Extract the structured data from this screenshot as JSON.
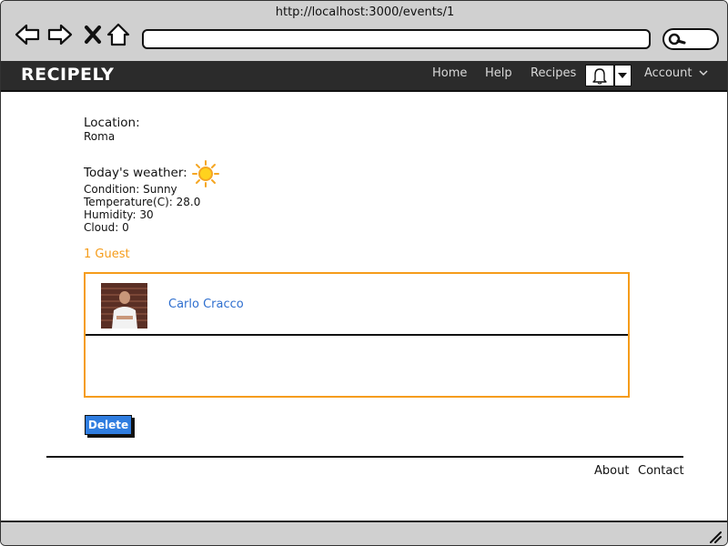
{
  "browser": {
    "url": "http://localhost:3000/events/1",
    "icons": [
      "back-icon",
      "forward-icon",
      "close-icon",
      "home-icon",
      "search-icon"
    ]
  },
  "navbar": {
    "brand": "RECIPELY",
    "links": {
      "home": "Home",
      "help": "Help",
      "recipes": "Recipes",
      "account": "Account"
    }
  },
  "event": {
    "location_label": "Location:",
    "location_value": "Roma",
    "weather_title": "Today's weather:",
    "weather_icon": "sun-icon",
    "condition": "Condition: Sunny",
    "temperature": "Temperature(C): 28.0",
    "humidity": "Humidity: 30",
    "cloud": "Cloud: 0",
    "guests_label": "1 Guest",
    "guests": [
      {
        "name": "Carlo Cracco"
      }
    ],
    "delete_label": "Delete"
  },
  "footer": {
    "about": "About",
    "contact": "Contact"
  },
  "colors": {
    "accent_orange": "#f59c1a",
    "link_blue": "#2f6fcf",
    "button_blue": "#2f7de0",
    "nav_dark": "#2b2b2b"
  }
}
